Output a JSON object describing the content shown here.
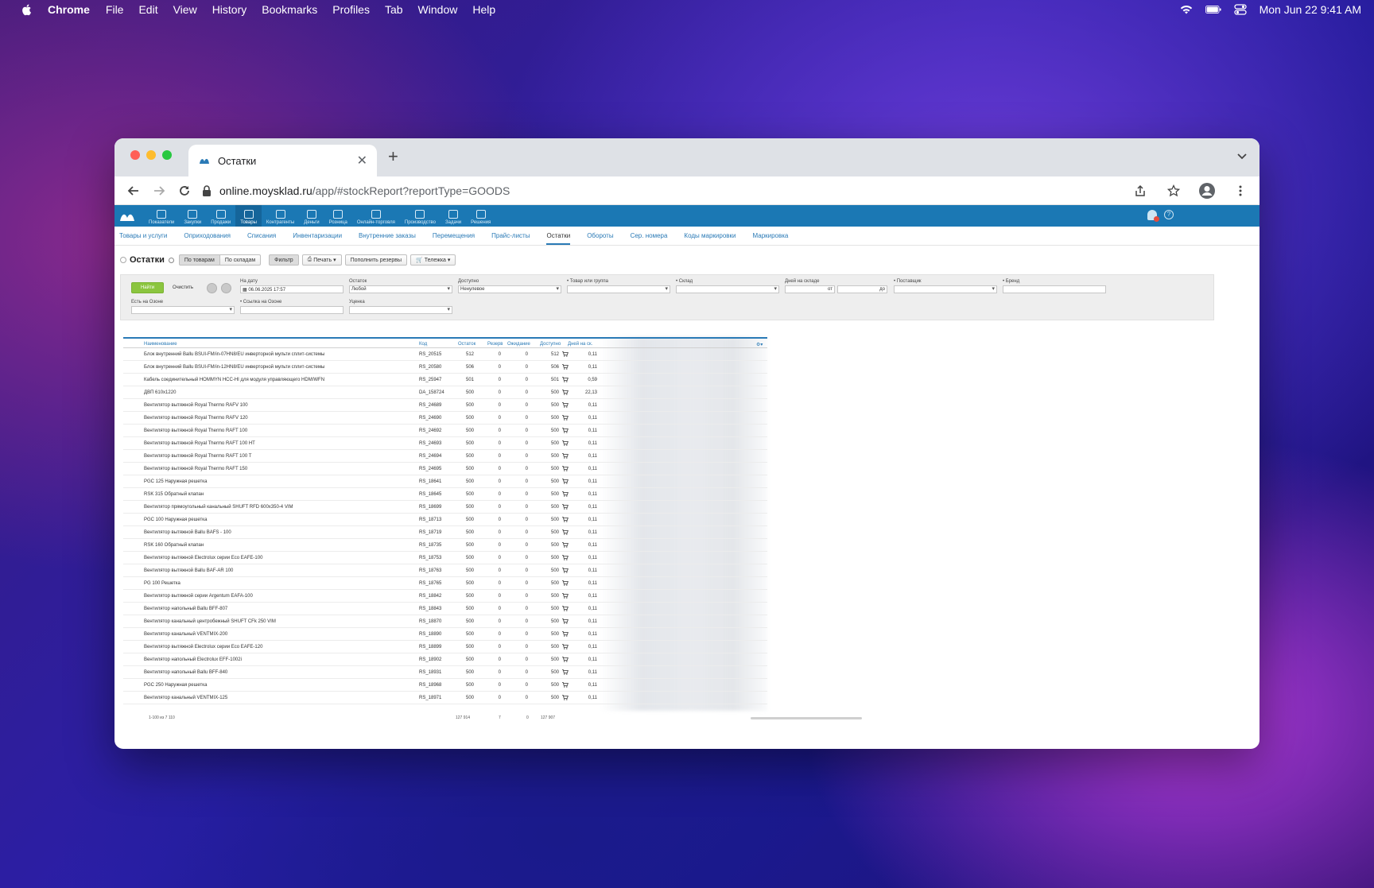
{
  "menubar": {
    "app_name": "Chrome",
    "items": [
      "File",
      "Edit",
      "View",
      "History",
      "Bookmarks",
      "Profiles",
      "Tab",
      "Window",
      "Help"
    ],
    "clock": "Mon Jun 22  9:41 AM"
  },
  "browser": {
    "tab_title": "Остатки",
    "url_host": "online.moysklad.ru",
    "url_path": "/app/#stockReport?reportType=GOODS"
  },
  "app": {
    "top_nav": [
      "Показатели",
      "Закупки",
      "Продажи",
      "Товары",
      "Контрагенты",
      "Деньги",
      "Розница",
      "Онлайн-торговля",
      "Производство",
      "Задачи",
      "Решения"
    ],
    "top_nav_active": 3,
    "sub_nav": [
      "Товары и услуги",
      "Оприходования",
      "Списания",
      "Инвентаризации",
      "Внутренние заказы",
      "Перемещения",
      "Прайс-листы",
      "Остатки",
      "Обороты",
      "Сер. номера",
      "Коды маркировки",
      "Маркировка"
    ],
    "sub_nav_active": 7,
    "page_title": "Остатки",
    "toolbar": {
      "by_goods": "По товарам",
      "by_warehouses": "По складам",
      "filter": "Фильтр",
      "print": "Печать",
      "replenish": "Пополнить резервы",
      "cart": "Тележка"
    },
    "filter": {
      "find": "Найти",
      "clear": "Очистить",
      "date_label": "На дату",
      "date_value": "06.06.2025 17:57",
      "stock_label": "Остаток",
      "stock_value": "Любой",
      "available_label": "Доступно",
      "available_value": "Ненулевое",
      "goods_label": "Товар или группа",
      "warehouse_label": "Склад",
      "days_label": "Дней на складе",
      "days_from": "от",
      "days_to": "до",
      "supplier_label": "Поставщик",
      "brand_label": "Бренд",
      "ozon_label": "Есть на Озоне",
      "ozon_link_label": "Ссылка на Озоне",
      "markdown_label": "Уценка"
    },
    "table": {
      "headers": [
        "Наименование",
        "Код",
        "Остаток",
        "Резерв",
        "Ожидание",
        "Доступно",
        "Дней на ск."
      ],
      "rows": [
        [
          "Блок внутренний Ballu BSUI-FM/in-07HN8/EU инверторной мульти сплит-системы",
          "RS_20515",
          "512",
          "0",
          "0",
          "512",
          "0,11"
        ],
        [
          "Блок внутренний Ballu BSUI-FM/in-12HN8/EU инверторной мульти сплит-системы",
          "RS_20580",
          "506",
          "0",
          "0",
          "506",
          "0,11"
        ],
        [
          "Кабель соединительный HOMMYN HCC-HI для модуля управляющего HDM/WFN",
          "RS_25947",
          "501",
          "0",
          "0",
          "501",
          "0,59"
        ],
        [
          "ДВП 610х1220",
          "DA_158724",
          "500",
          "0",
          "0",
          "500",
          "22,13"
        ],
        [
          "Вентилятор вытяжной Royal Thermo RAFV 100",
          "RS_24689",
          "500",
          "0",
          "0",
          "500",
          "0,11"
        ],
        [
          "Вентилятор вытяжной Royal Thermo RAFV 120",
          "RS_24690",
          "500",
          "0",
          "0",
          "500",
          "0,11"
        ],
        [
          "Вентилятор вытяжной Royal Thermo RAFT 100",
          "RS_24692",
          "500",
          "0",
          "0",
          "500",
          "0,11"
        ],
        [
          "Вентилятор вытяжной Royal Thermo RAFT 100 HT",
          "RS_24693",
          "500",
          "0",
          "0",
          "500",
          "0,11"
        ],
        [
          "Вентилятор вытяжной Royal Thermo RAFT 100 T",
          "RS_24694",
          "500",
          "0",
          "0",
          "500",
          "0,11"
        ],
        [
          "Вентилятор вытяжной Royal Thermo RAFT 150",
          "RS_24695",
          "500",
          "0",
          "0",
          "500",
          "0,11"
        ],
        [
          "PGC 125 Наружная решетка",
          "RS_18641",
          "500",
          "0",
          "0",
          "500",
          "0,11"
        ],
        [
          "RSK 315 Обратный клапан",
          "RS_18645",
          "500",
          "0",
          "0",
          "500",
          "0,11"
        ],
        [
          "Вентилятор прямоугольный канальный SHUFT RFD 600х350-4 VIM",
          "RS_18699",
          "500",
          "0",
          "0",
          "500",
          "0,11"
        ],
        [
          "PGC 100 Наружная решетка",
          "RS_18713",
          "500",
          "0",
          "0",
          "500",
          "0,11"
        ],
        [
          "Вентилятор вытяжной Ballu BAFS - 100",
          "RS_18719",
          "500",
          "0",
          "0",
          "500",
          "0,11"
        ],
        [
          "RSK 160 Обратный клапан",
          "RS_18735",
          "500",
          "0",
          "0",
          "500",
          "0,11"
        ],
        [
          "Вентилятор вытяжной Electrolux серии Eco EAFE-100",
          "RS_18753",
          "500",
          "0",
          "0",
          "500",
          "0,11"
        ],
        [
          "Вентилятор вытяжной Ballu BAF-AR 100",
          "RS_18763",
          "500",
          "0",
          "0",
          "500",
          "0,11"
        ],
        [
          "PG 100 Решетка",
          "RS_18765",
          "500",
          "0",
          "0",
          "500",
          "0,11"
        ],
        [
          "Вентилятор вытяжной серии Argentum EAFA-100",
          "RS_18842",
          "500",
          "0",
          "0",
          "500",
          "0,11"
        ],
        [
          "Вентилятор напольный Ballu BFF-807",
          "RS_18843",
          "500",
          "0",
          "0",
          "500",
          "0,11"
        ],
        [
          "Вентилятор канальный центробежный SHUFT CFk 250 VIM",
          "RS_18870",
          "500",
          "0",
          "0",
          "500",
          "0,11"
        ],
        [
          "Вентилятор канальный VENTMIX-200",
          "RS_18890",
          "500",
          "0",
          "0",
          "500",
          "0,11"
        ],
        [
          "Вентилятор вытяжной Electrolux серии Eco EAFE-120",
          "RS_18899",
          "500",
          "0",
          "0",
          "500",
          "0,11"
        ],
        [
          "Вентилятор напольный Electrolux EFF-1002i",
          "RS_18902",
          "500",
          "0",
          "0",
          "500",
          "0,11"
        ],
        [
          "Вентилятор напольный Ballu BFF-840",
          "RS_18931",
          "500",
          "0",
          "0",
          "500",
          "0,11"
        ],
        [
          "PGC 250 Наружная решетка",
          "RS_18968",
          "500",
          "0",
          "0",
          "500",
          "0,11"
        ],
        [
          "Вентилятор канальный VENTMIX-125",
          "RS_18971",
          "500",
          "0",
          "0",
          "500",
          "0,11"
        ]
      ],
      "footer_pager": "1-100 из 7 110",
      "footer_stock_total": "127 914",
      "footer_reserve_total": "7",
      "footer_wait_total": "0",
      "footer_available_total": "127 907"
    }
  }
}
